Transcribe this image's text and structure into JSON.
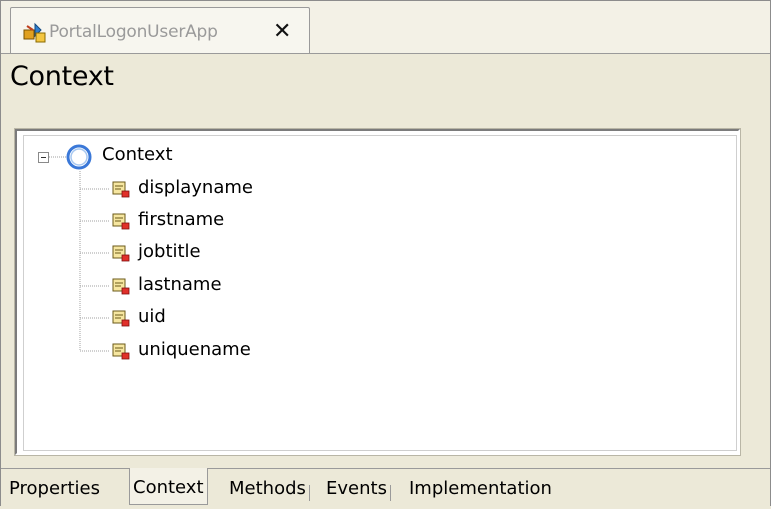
{
  "editor": {
    "tab_title": "PortalLogonUserApp",
    "close_glyph": "✕",
    "heading": "Context"
  },
  "tree": {
    "root": {
      "label": "Context",
      "icon": "context-node-icon",
      "expanded": true
    },
    "attributes": [
      {
        "label": "displayname",
        "icon": "value-attribute-icon"
      },
      {
        "label": "firstname",
        "icon": "value-attribute-icon"
      },
      {
        "label": "jobtitle",
        "icon": "value-attribute-icon"
      },
      {
        "label": "lastname",
        "icon": "value-attribute-icon"
      },
      {
        "label": "uid",
        "icon": "value-attribute-icon"
      },
      {
        "label": "uniquename",
        "icon": "value-attribute-icon"
      }
    ]
  },
  "bottom_tabs": [
    {
      "label": "Properties",
      "active": false
    },
    {
      "label": "Context",
      "active": true
    },
    {
      "label": "Methods",
      "active": false
    },
    {
      "label": "Events",
      "active": false
    },
    {
      "label": "Implementation",
      "active": false
    }
  ],
  "colors": {
    "background": "#ece9d8",
    "tab_text_inactive": "#9a9a9a",
    "root_icon_blue": "#3a78d8"
  }
}
